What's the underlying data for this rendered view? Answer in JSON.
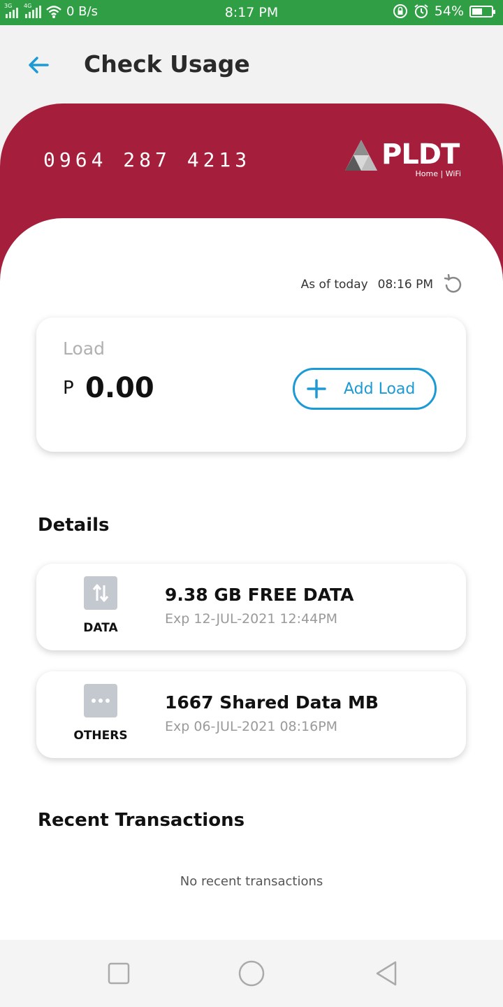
{
  "status_bar": {
    "net_3g": "3G",
    "net_4g": "4G",
    "speed": "0 B/s",
    "time": "8:17 PM",
    "battery_pct": "54%",
    "battery_level": 0.54,
    "icons": [
      "signal-icon",
      "wifi-icon",
      "lock-rotation-icon",
      "alarm-icon",
      "battery-icon"
    ]
  },
  "header": {
    "title": "Check Usage",
    "back_icon": "arrow-left-icon"
  },
  "account": {
    "number": "0964 287 4213",
    "logo_word": "PLDT",
    "logo_sub": "Home | WiFi"
  },
  "as_of": {
    "label": "As of today",
    "time": "08:16 PM",
    "icon": "refresh-icon"
  },
  "load": {
    "label": "Load",
    "currency": "P",
    "amount": "0.00",
    "add_button": "Add Load"
  },
  "details": {
    "title": "Details",
    "items": [
      {
        "type": "DATA",
        "icon": "data-transfer-icon",
        "name": "9.38 GB FREE DATA",
        "expiry": "Exp 12-JUL-2021 12:44PM"
      },
      {
        "type": "OTHERS",
        "icon": "more-dots-icon",
        "name": "1667 Shared Data MB",
        "expiry": "Exp 06-JUL-2021 08:16PM"
      }
    ]
  },
  "recent": {
    "title": "Recent Transactions",
    "empty_text": "No recent transactions"
  },
  "colors": {
    "status_green": "#2f9e44",
    "brand_red": "#a51f3c",
    "accent_blue": "#1c9ad6"
  }
}
